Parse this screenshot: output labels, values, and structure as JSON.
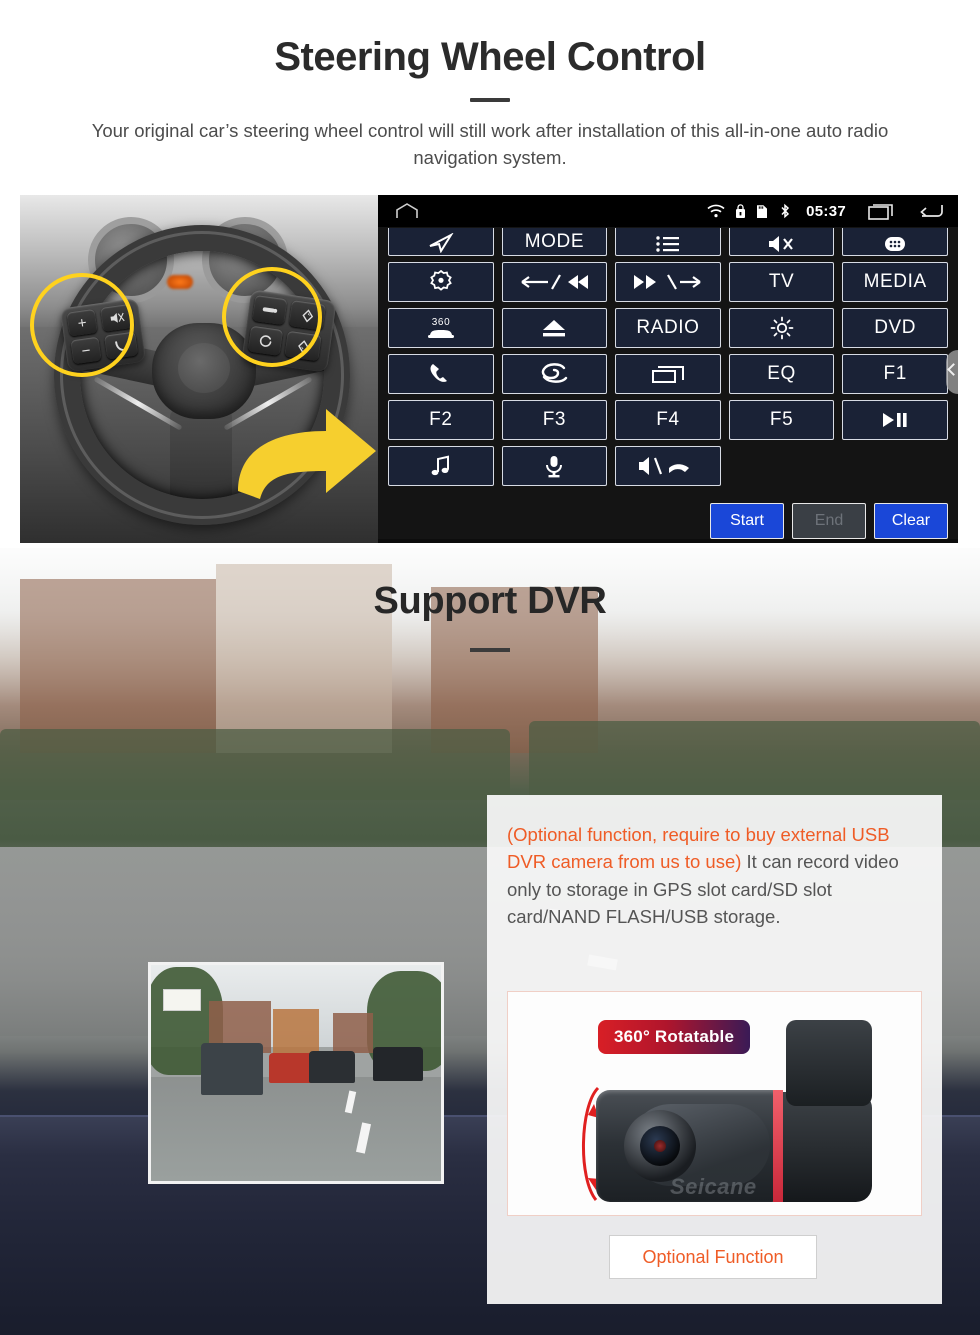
{
  "section1": {
    "title": "Steering Wheel Control",
    "subtitle": "Your original car’s steering wheel control will still work after installation of this all-in-one auto radio navigation system.",
    "head_unit": {
      "status_bar": {
        "home_icon": "home-icon",
        "wifi_icon": "wifi-icon",
        "lock_icon": "lock-icon",
        "sdcard_icon": "sd-card-icon",
        "bluetooth_icon": "bluetooth-icon",
        "clock": "05:37",
        "recents_icon": "recents-icon",
        "back_icon": "back-icon"
      },
      "rows": [
        [
          {
            "label": "",
            "icon": "navigation-arrow-icon"
          },
          {
            "label": "MODE",
            "icon": ""
          },
          {
            "label": "",
            "icon": "list-icon"
          },
          {
            "label": "",
            "icon": "mute-icon"
          },
          {
            "label": "",
            "icon": "apps-icon"
          }
        ],
        [
          {
            "label": "",
            "icon": "target-icon"
          },
          {
            "label": "",
            "icon": "prev-track-icon"
          },
          {
            "label": "",
            "icon": "next-track-icon"
          },
          {
            "label": "TV",
            "icon": ""
          },
          {
            "label": "MEDIA",
            "icon": ""
          }
        ],
        [
          {
            "label": "",
            "icon": "360-camera-icon"
          },
          {
            "label": "",
            "icon": "eject-icon"
          },
          {
            "label": "RADIO",
            "icon": ""
          },
          {
            "label": "",
            "icon": "brightness-icon"
          },
          {
            "label": "DVD",
            "icon": ""
          }
        ],
        [
          {
            "label": "",
            "icon": "phone-icon"
          },
          {
            "label": "",
            "icon": "swirl-icon"
          },
          {
            "label": "",
            "icon": "window-icon"
          },
          {
            "label": "EQ",
            "icon": ""
          },
          {
            "label": "F1",
            "icon": ""
          }
        ],
        [
          {
            "label": "F2",
            "icon": ""
          },
          {
            "label": "F3",
            "icon": ""
          },
          {
            "label": "F4",
            "icon": ""
          },
          {
            "label": "F5",
            "icon": ""
          },
          {
            "label": "",
            "icon": "play-pause-icon"
          }
        ],
        [
          {
            "label": "",
            "icon": "music-note-icon"
          },
          {
            "label": "",
            "icon": "microphone-icon"
          },
          {
            "label": "",
            "icon": "speaker-call-icon"
          },
          {
            "label": "",
            "icon": ""
          },
          {
            "label": "",
            "icon": ""
          }
        ]
      ],
      "actions": [
        {
          "label": "Start",
          "state": "primary"
        },
        {
          "label": "End",
          "state": "disabled"
        },
        {
          "label": "Clear",
          "state": "primary"
        }
      ],
      "edge_handle_icon": "chevron-left-icon"
    },
    "photo": {
      "alt": "steering-wheel-photo",
      "left_pad_keys": [
        "+",
        "−",
        "mute-mic-icon",
        "answer-call-icon"
      ],
      "right_pad_keys": [
        "source-icon",
        "up-arrow-icon",
        "menu-circle-icon",
        "down-arrow-icon"
      ],
      "highlight_color": "#ffd21e"
    }
  },
  "section2": {
    "title": "Support DVR",
    "info": {
      "warning": "(Optional function, require to buy external USB DVR camera from us to use)",
      "body": "It can record video only to storage in GPS slot card/SD slot card/NAND FLASH/USB storage.",
      "warning_color": "#ef5c26"
    },
    "camera_panel": {
      "badge": "360° Rotatable",
      "watermark": "Seicane",
      "rotation_arrow_icon": "rotation-arrow-icon"
    },
    "optional_button": {
      "label": "Optional Function",
      "color": "#ef5c26"
    },
    "video_inset": {
      "alt": "dashcam-video-preview"
    }
  }
}
